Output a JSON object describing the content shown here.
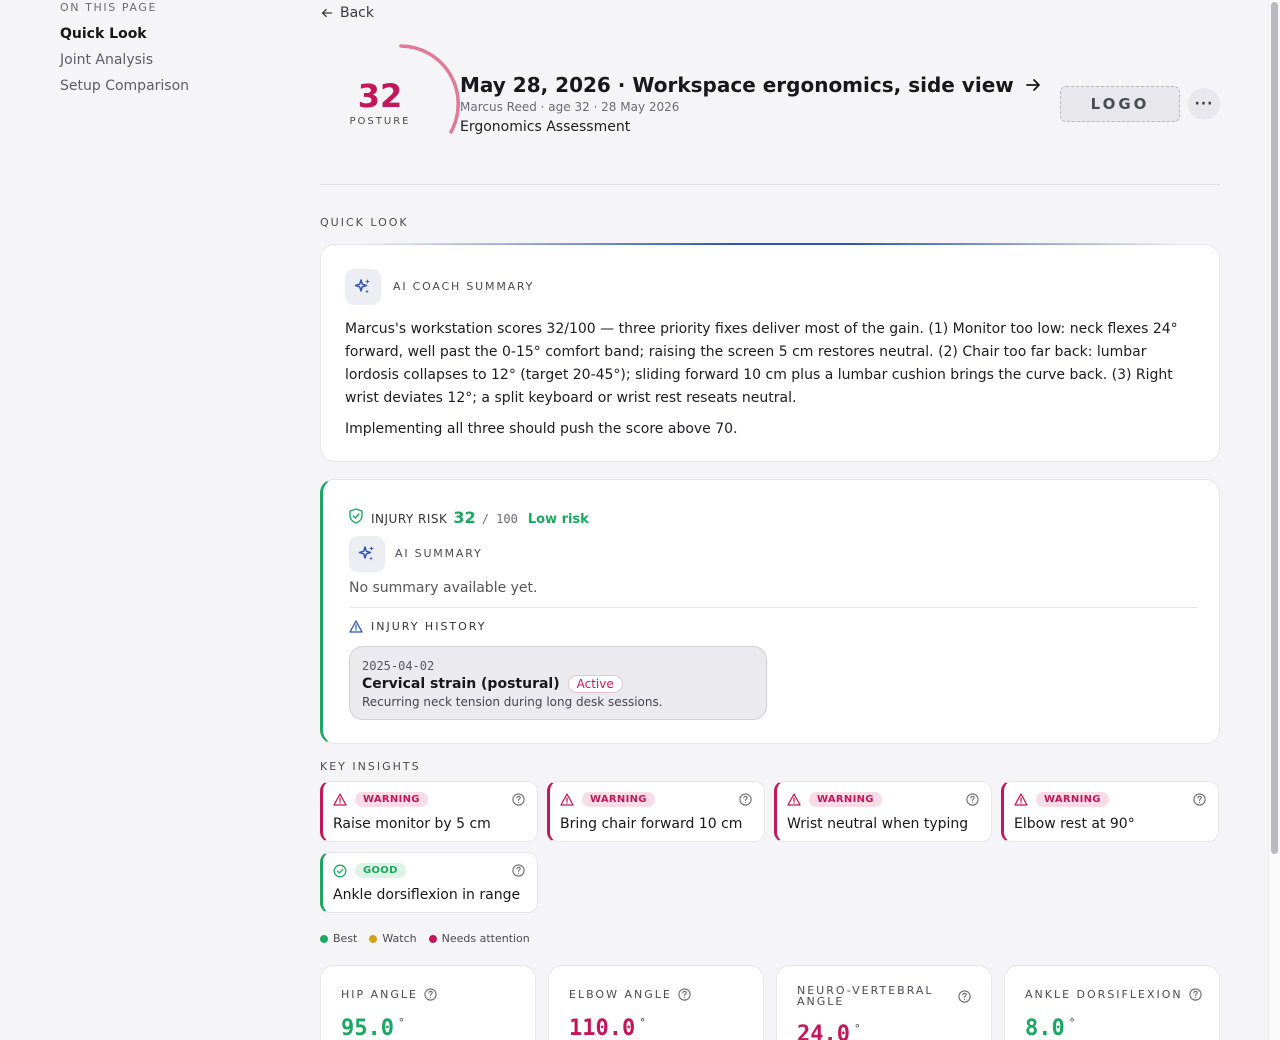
{
  "toc": {
    "title": "ON THIS PAGE",
    "items": [
      {
        "label": "Quick Look",
        "active": true
      },
      {
        "label": "Joint Analysis",
        "active": false
      },
      {
        "label": "Setup Comparison",
        "active": false
      }
    ]
  },
  "header": {
    "back_label": "Back",
    "score": {
      "value": "32",
      "label": "POSTURE",
      "color": "#c2185b"
    },
    "title": "May 28, 2026 · Workspace ergonomics, side view",
    "subline": "Marcus Reed · age 32 · 28 May 2026",
    "assessment": "Ergonomics Assessment",
    "logo_text": "LOGO",
    "more_label": "···"
  },
  "quick_look": {
    "section_label": "QUICK LOOK",
    "ai_coach": {
      "heading": "AI COACH SUMMARY",
      "paragraph_1": "Marcus's workstation scores 32/100 — three priority fixes deliver most of the gain. (1) Monitor too low: neck flexes 24° forward, well past the 0-15° comfort band; raising the screen 5 cm restores neutral. (2) Chair too far back: lumbar lordosis collapses to 12° (target 20-45°); sliding forward 10 cm plus a lumbar cushion brings the curve back. (3) Right wrist deviates 12°; a split keyboard or wrist rest reseats neutral.",
      "paragraph_2": "Implementing all three should push the score above 70."
    },
    "injury_risk": {
      "label": "INJURY RISK",
      "value": "32",
      "denominator": "/ 100",
      "level": "Low risk",
      "ai_summary_heading": "AI SUMMARY",
      "no_summary": "No summary available yet.",
      "history_label": "INJURY HISTORY",
      "history": [
        {
          "date": "2025-04-02",
          "title": "Cervical strain (postural)",
          "status": "Active",
          "description": "Recurring neck tension during long desk sessions."
        }
      ]
    }
  },
  "key_insights": {
    "section_label": "KEY INSIGHTS",
    "items": [
      {
        "severity": "WARNING",
        "text": "Raise monitor by 5 cm"
      },
      {
        "severity": "WARNING",
        "text": "Bring chair forward 10 cm"
      },
      {
        "severity": "WARNING",
        "text": "Wrist neutral when typing"
      },
      {
        "severity": "WARNING",
        "text": "Elbow rest at 90°"
      },
      {
        "severity": "GOOD",
        "text": "Ankle dorsiflexion in range"
      }
    ],
    "legend": [
      {
        "label": "Best",
        "color": "#1aa862"
      },
      {
        "label": "Watch",
        "color": "#d4a017"
      },
      {
        "label": "Needs attention",
        "color": "#c2185b"
      }
    ]
  },
  "metrics": [
    {
      "label": "HIP ANGLE",
      "value": "95.0",
      "unit": "°",
      "status": "good"
    },
    {
      "label": "ELBOW ANGLE",
      "value": "110.0",
      "unit": "°",
      "status": "attention"
    },
    {
      "label": "NEURO-VERTEBRAL ANGLE",
      "value": "24.0",
      "unit": "°",
      "status": "attention"
    },
    {
      "label": "ANKLE DORSIFLEXION",
      "value": "8.0",
      "unit": "°",
      "status": "good"
    }
  ],
  "colors": {
    "accent_red": "#c2185b",
    "accent_green": "#1aa862",
    "ai_blue": "#2e56b3"
  }
}
